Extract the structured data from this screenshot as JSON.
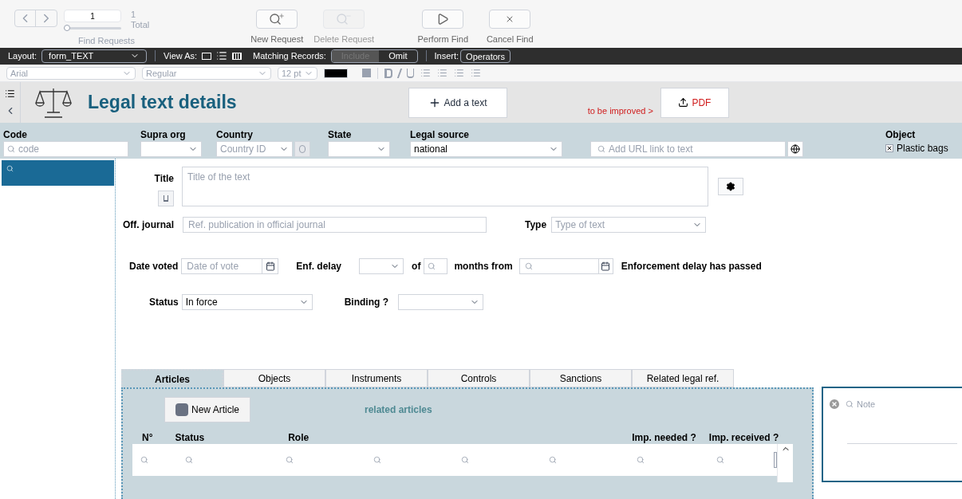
{
  "toolbar": {
    "record": "1",
    "count": "1",
    "count_label": "Total",
    "nav_label": "Find Requests",
    "slider": {
      "level": 0
    },
    "buttons": [
      {
        "kind": "new",
        "label": "New Request",
        "disabled": false
      },
      {
        "kind": "delete",
        "label": "Delete Request",
        "disabled": true
      },
      {
        "kind": "perform",
        "label": "Perform Find",
        "disabled": false
      },
      {
        "kind": "cancel",
        "label": "Cancel Find",
        "disabled": false
      }
    ]
  },
  "layout_bar": {
    "layout_label": "Layout:",
    "layout": "form_TEXT",
    "view_as_label": "View As:",
    "matching_label": "Matching Records:",
    "matching": [
      {
        "label": "Include",
        "selected": true
      },
      {
        "label": "Omit",
        "selected": false
      }
    ],
    "insert_label": "Insert:",
    "insert": "Operators"
  },
  "format_bar": {
    "font": "Arial",
    "style": "Regular",
    "size": "12 pt"
  },
  "header": {
    "title": "Legal text details",
    "add_button": "Add a text",
    "note": "to be improved >",
    "pdf_button": "PDF"
  },
  "filters": [
    {
      "kind": "search",
      "label": "Code",
      "placeholder": "code"
    },
    {
      "kind": "select",
      "label": "Supra org"
    },
    {
      "kind": "select",
      "label": "Country",
      "placeholder": "Country ID"
    },
    {
      "kind": "select",
      "label": "State"
    },
    {
      "kind": "select",
      "label": "Legal source",
      "value": "national"
    },
    {
      "kind": "url",
      "placeholder": "Add URL link to text"
    }
  ],
  "object": {
    "label": "Object",
    "items": [
      {
        "label": "Plastic bags",
        "checked": true
      }
    ]
  },
  "form": {
    "title_label": "Title",
    "title_placeholder": "Title of the text",
    "journal_label": "Off. journal",
    "journal_placeholder": "Ref. publication in official journal",
    "type_label": "Type",
    "type_placeholder": "Type of text",
    "date_label": "Date voted",
    "date_placeholder": "Date of vote",
    "delay_label": "Enf. delay",
    "of_label": "of",
    "months_label": "months from",
    "passed_label": "Enforcement delay has passed",
    "status_label": "Status",
    "status_value": "In force",
    "binding_label": "Binding ?"
  },
  "tabs": [
    {
      "label": "Articles",
      "selected": true
    },
    {
      "label": "Objects",
      "selected": false
    },
    {
      "label": "Instruments",
      "selected": false
    },
    {
      "label": "Controls",
      "selected": false
    },
    {
      "label": "Sanctions",
      "selected": false
    },
    {
      "label": "Related legal ref.",
      "selected": false
    }
  ],
  "articles": {
    "new_button": "New Article",
    "related": "related articles",
    "columns": [
      "N°",
      "Status",
      "Role",
      "Imp. needed ?",
      "Imp. received ?"
    ]
  },
  "note": {
    "placeholder": "Note"
  }
}
